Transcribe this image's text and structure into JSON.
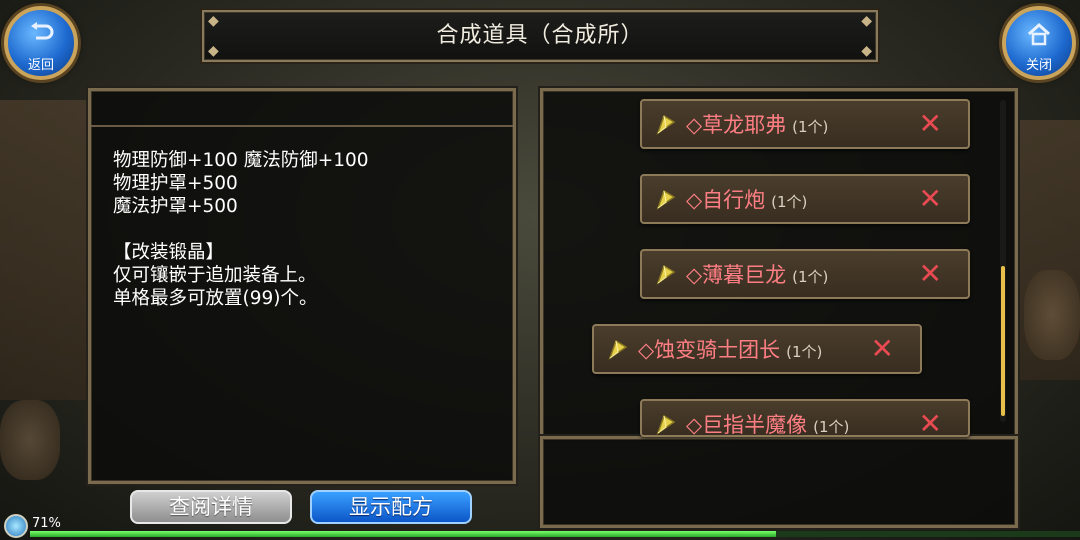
{
  "header": {
    "title": "合成道具（合成所）",
    "back_label": "返回",
    "close_label": "关闭"
  },
  "description": {
    "text": "物理防御+100 魔法防御+100\n物理护罩+500\n魔法护罩+500\n\n【改装锻晶】\n仅可镶嵌于追加装备上。\n单格最多可放置(99)个。"
  },
  "materials": {
    "items": [
      {
        "name": "◇草龙耶弗",
        "qty": "(1个)",
        "remove": "✕"
      },
      {
        "name": "◇自行炮",
        "qty": "(1个)",
        "remove": "✕"
      },
      {
        "name": "◇薄暮巨龙",
        "qty": "(1个)",
        "remove": "✕"
      },
      {
        "name": "◇蚀变骑士团长",
        "qty": "(1个)",
        "remove": "✕"
      },
      {
        "name": "◇巨指半魔像",
        "qty": "(1个)",
        "remove": "✕"
      }
    ]
  },
  "buttons": {
    "view_details": "查阅详情",
    "show_recipe": "显示配方"
  },
  "status": {
    "percent": "71%",
    "progress_fraction": 0.71
  },
  "colors": {
    "item_name": "#ff7e84",
    "remove_x": "#e84a52",
    "accent_blue": "#1e6ad0",
    "gold_border": "#c9a45a"
  },
  "icons": {
    "back": "return-arrow-icon",
    "close": "home-icon",
    "item_gem": "yellow-crystal-icon"
  }
}
